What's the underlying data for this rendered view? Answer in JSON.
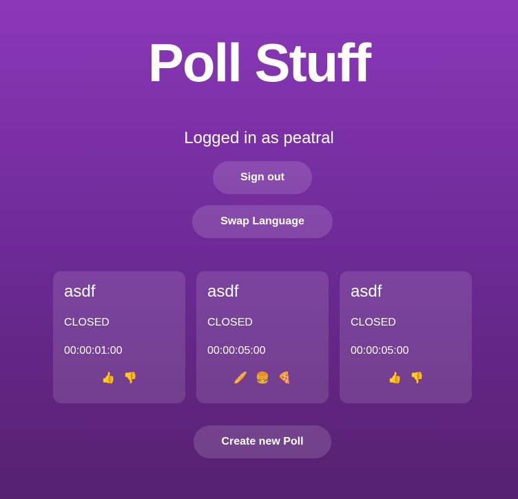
{
  "header": {
    "title": "Poll Stuff",
    "logged_in_text": "Logged in as peatral"
  },
  "buttons": {
    "sign_out": "Sign out",
    "swap_language": "Swap Language",
    "create_poll": "Create new Poll"
  },
  "polls": [
    {
      "title": "asdf",
      "status": "CLOSED",
      "duration": "00:00:01:00",
      "options": [
        "👍",
        "👎"
      ]
    },
    {
      "title": "asdf",
      "status": "CLOSED",
      "duration": "00:00:05:00",
      "options": [
        "🥖",
        "🍔",
        "🍕"
      ]
    },
    {
      "title": "asdf",
      "status": "CLOSED",
      "duration": "00:00:05:00",
      "options": [
        "👍",
        "👎"
      ]
    }
  ]
}
